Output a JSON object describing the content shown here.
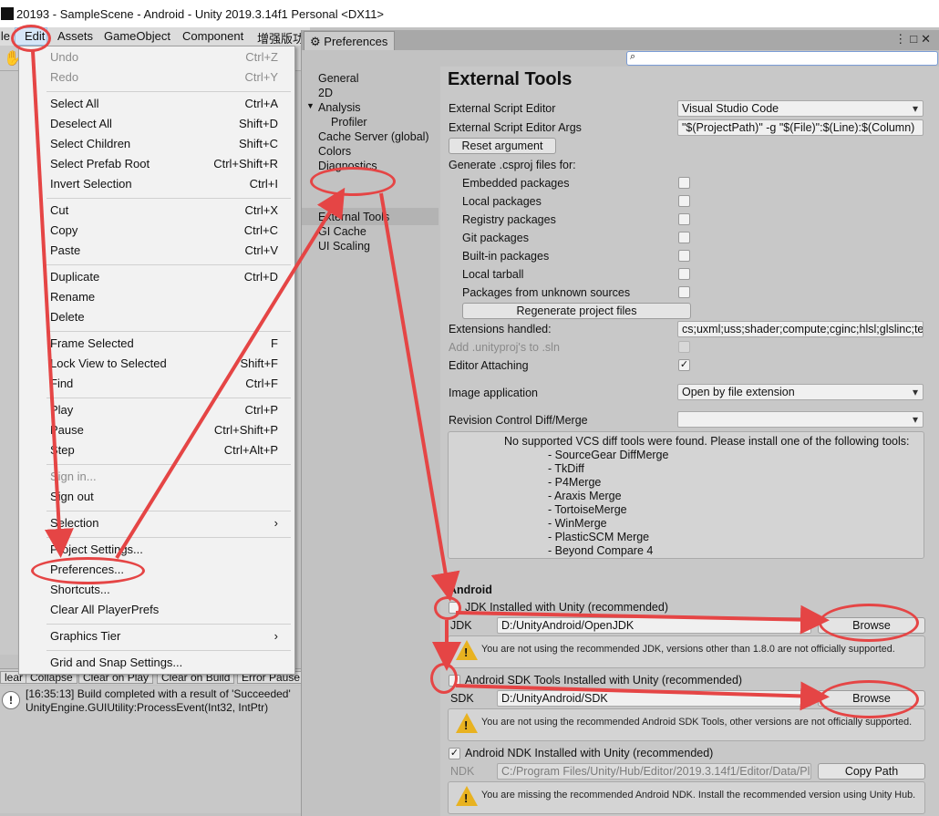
{
  "window": {
    "title": "20193 - SampleScene - Android - Unity 2019.3.14f1 Personal <DX11>"
  },
  "menubar": {
    "file": "ile",
    "edit": "Edit",
    "assets": "Assets",
    "gameobject": "GameObject",
    "component": "Component",
    "extra": "增强版功"
  },
  "edit_menu": {
    "items": [
      {
        "label": "Undo",
        "shortcut": "Ctrl+Z",
        "disabled": true
      },
      {
        "label": "Redo",
        "shortcut": "Ctrl+Y",
        "disabled": true
      },
      {
        "label": "Select All",
        "shortcut": "Ctrl+A"
      },
      {
        "label": "Deselect All",
        "shortcut": "Shift+D"
      },
      {
        "label": "Select Children",
        "shortcut": "Shift+C"
      },
      {
        "label": "Select Prefab Root",
        "shortcut": "Ctrl+Shift+R"
      },
      {
        "label": "Invert Selection",
        "shortcut": "Ctrl+I"
      },
      {
        "label": "Cut",
        "shortcut": "Ctrl+X"
      },
      {
        "label": "Copy",
        "shortcut": "Ctrl+C"
      },
      {
        "label": "Paste",
        "shortcut": "Ctrl+V"
      },
      {
        "label": "Duplicate",
        "shortcut": "Ctrl+D"
      },
      {
        "label": "Rename",
        "shortcut": ""
      },
      {
        "label": "Delete",
        "shortcut": ""
      },
      {
        "label": "Frame Selected",
        "shortcut": "F"
      },
      {
        "label": "Lock View to Selected",
        "shortcut": "Shift+F"
      },
      {
        "label": "Find",
        "shortcut": "Ctrl+F"
      },
      {
        "label": "Play",
        "shortcut": "Ctrl+P"
      },
      {
        "label": "Pause",
        "shortcut": "Ctrl+Shift+P"
      },
      {
        "label": "Step",
        "shortcut": "Ctrl+Alt+P"
      },
      {
        "label": "Sign in...",
        "shortcut": "",
        "disabled": true
      },
      {
        "label": "Sign out",
        "shortcut": ""
      },
      {
        "label": "Selection",
        "shortcut": "›"
      },
      {
        "label": "Project Settings...",
        "shortcut": ""
      },
      {
        "label": "Preferences...",
        "shortcut": ""
      },
      {
        "label": "Shortcuts...",
        "shortcut": ""
      },
      {
        "label": "Clear All PlayerPrefs",
        "shortcut": ""
      },
      {
        "label": "Graphics Tier",
        "shortcut": "›"
      },
      {
        "label": "Grid and Snap Settings...",
        "shortcut": ""
      }
    ]
  },
  "console": {
    "buttons": [
      "lear",
      "Collapse",
      "Clear on Play",
      "Clear on Build",
      "Error Pause"
    ],
    "line1": "[16:35:13] Build completed with a result of 'Succeeded'",
    "line2": "UnityEngine.GUIUtility:ProcessEvent(Int32, IntPtr)"
  },
  "preferences": {
    "tab_label": "Preferences",
    "categories": [
      "General",
      "2D",
      "Analysis",
      "Profiler",
      "Cache Server (global)",
      "Colors",
      "Diagnostics",
      "External Tools",
      "GI Cache",
      "UI Scaling"
    ],
    "section_title": "External Tools",
    "script_editor_label": "External Script Editor",
    "script_editor_value": "Visual Studio Code",
    "script_args_label": "External Script Editor Args",
    "script_args_value": "\"$(ProjectPath)\" -g \"$(File)\":$(Line):$(Column)",
    "reset_button": "Reset argument",
    "csproj_label": "Generate .csproj files for:",
    "csproj_items": [
      "Embedded packages",
      "Local packages",
      "Registry packages",
      "Git packages",
      "Built-in packages",
      "Local tarball",
      "Packages from unknown sources"
    ],
    "regenerate_button": "Regenerate project files",
    "extensions_label": "Extensions handled:",
    "extensions_value": "cs;uxml;uss;shader;compute;cginc;hlsl;glslinc;te",
    "add_unityproj_label": "Add .unityproj's to .sln",
    "editor_attaching_label": "Editor Attaching",
    "image_app_label": "Image application",
    "image_app_value": "Open by file extension",
    "revision_label": "Revision Control Diff/Merge",
    "vcs_message": "No supported VCS diff tools were found. Please install one of the following tools:",
    "vcs_tools": [
      "- SourceGear DiffMerge",
      "- TkDiff",
      "- P4Merge",
      "- Araxis Merge",
      "- TortoiseMerge",
      "- WinMerge",
      "- PlasticSCM Merge",
      "- Beyond Compare 4"
    ],
    "android_header": "Android",
    "jdk_checkbox": "JDK Installed with Unity (recommended)",
    "jdk_label": "JDK",
    "jdk_path": "D:/UnityAndroid/OpenJDK",
    "browse": "Browse",
    "jdk_warning": "You are not using the recommended JDK, versions other than 1.8.0 are not officially supported.",
    "sdk_checkbox": "Android SDK Tools Installed with Unity (recommended)",
    "sdk_label": "SDK",
    "sdk_path": "D:/UnityAndroid/SDK",
    "sdk_warning": "You are not using the recommended Android SDK Tools, other versions are not officially supported.",
    "ndk_checkbox": "Android NDK Installed with Unity (recommended)",
    "ndk_label": "NDK",
    "ndk_path": "C:/Program Files/Unity/Hub/Editor/2019.3.14f1/Editor/Data/Pl",
    "copy_path": "Copy Path",
    "ndk_warning": "You are missing the recommended Android NDK. Install the recommended version using Unity Hub.",
    "checkmark": "✓"
  },
  "colors": {
    "annotation": "#e54545",
    "warning": "#e8b220"
  }
}
